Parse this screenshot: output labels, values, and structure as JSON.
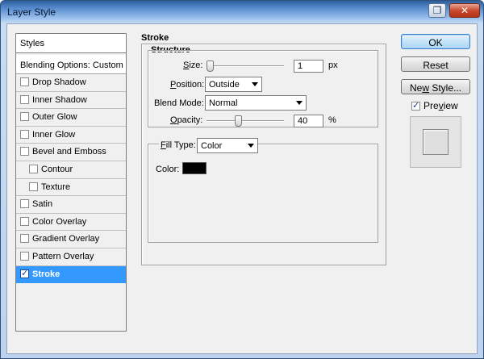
{
  "window": {
    "title": "Layer Style"
  },
  "titlebar": {
    "help_glyph": "❐",
    "close_glyph": "✕"
  },
  "styles_list": {
    "header": "Styles",
    "blending_options": "Blending Options: Custom",
    "items": [
      {
        "label": "Drop Shadow",
        "checked": false,
        "indent": false,
        "active": false
      },
      {
        "label": "Inner Shadow",
        "checked": false,
        "indent": false,
        "active": false
      },
      {
        "label": "Outer Glow",
        "checked": false,
        "indent": false,
        "active": false
      },
      {
        "label": "Inner Glow",
        "checked": false,
        "indent": false,
        "active": false
      },
      {
        "label": "Bevel and Emboss",
        "checked": false,
        "indent": false,
        "active": false
      },
      {
        "label": "Contour",
        "checked": false,
        "indent": true,
        "active": false
      },
      {
        "label": "Texture",
        "checked": false,
        "indent": true,
        "active": false
      },
      {
        "label": "Satin",
        "checked": false,
        "indent": false,
        "active": false
      },
      {
        "label": "Color Overlay",
        "checked": false,
        "indent": false,
        "active": false
      },
      {
        "label": "Gradient Overlay",
        "checked": false,
        "indent": false,
        "active": false
      },
      {
        "label": "Pattern Overlay",
        "checked": false,
        "indent": false,
        "active": false
      },
      {
        "label": "Stroke",
        "checked": true,
        "indent": false,
        "active": true
      }
    ]
  },
  "stroke": {
    "title": "Stroke",
    "structure": {
      "title": "Structure",
      "size_label_pre": "",
      "size_label_mnemonic": "S",
      "size_label_post": "ize:",
      "size_value": "1",
      "size_unit": "px",
      "size_slider_fraction": 0.0,
      "position_label_mnemonic": "P",
      "position_label_post": "osition:",
      "position_value": "Outside",
      "blend_label_pre": "Blend Mode:",
      "blend_value": "Normal",
      "opacity_label_mnemonic": "O",
      "opacity_label_post": "pacity:",
      "opacity_value": "40",
      "opacity_unit": "%",
      "opacity_slider_fraction": 0.4
    },
    "fill": {
      "fill_type_mnemonic": "F",
      "fill_type_post": "ill Type:",
      "fill_type_value": "Color",
      "color_label": "Color:",
      "color_hex": "#000000"
    }
  },
  "buttons": {
    "ok": "OK",
    "reset": "Reset",
    "new_style_mnemonic": "w",
    "new_style_pre": "Ne",
    "new_style_post": " Style...",
    "preview_label_mnemonic": "v",
    "preview_label_pre": "Pre",
    "preview_label_post": "iew",
    "preview_checked": true
  }
}
